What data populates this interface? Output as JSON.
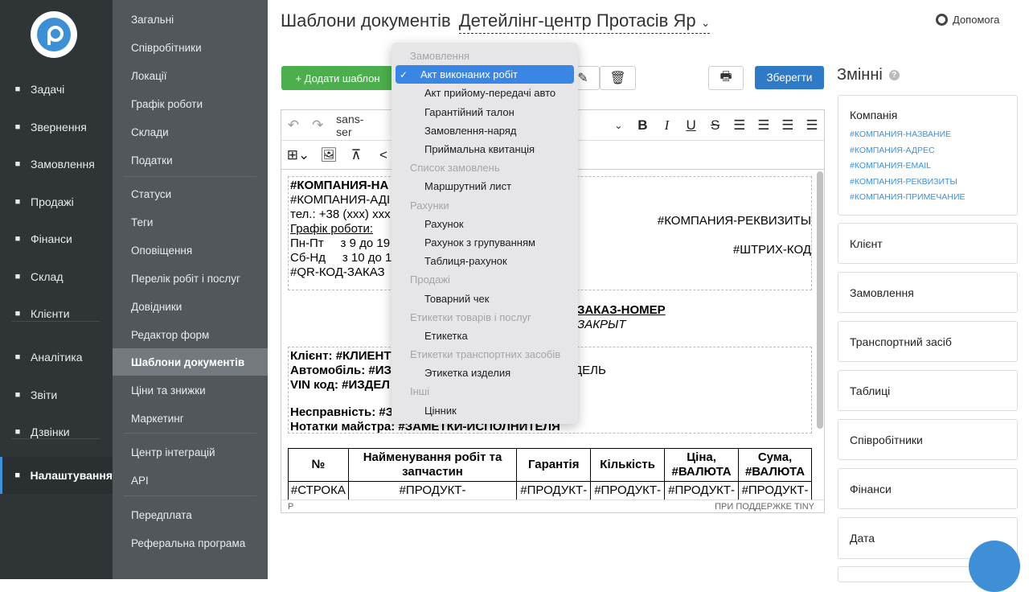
{
  "nav": [
    {
      "icon": "clipboard-icon",
      "label": "Задачі"
    },
    {
      "icon": "filter-icon",
      "label": "Звернення"
    },
    {
      "icon": "order-icon",
      "label": "Замовлення"
    },
    {
      "icon": "cart-icon",
      "label": "Продажі"
    },
    {
      "icon": "dollar-icon",
      "label": "Фінанси"
    },
    {
      "icon": "warehouse-icon",
      "label": "Склад"
    },
    {
      "icon": "users-icon",
      "label": "Клієнти"
    },
    {
      "icon": "chart-icon",
      "label": "Аналітика"
    },
    {
      "icon": "list-icon",
      "label": "Звіти"
    },
    {
      "icon": "phone-icon",
      "label": "Дзвінки"
    },
    {
      "icon": "gear-icon",
      "label": "Налаштування"
    }
  ],
  "submenu": [
    "Загальні",
    "Співробітники",
    "Локації",
    "Графік роботи",
    "Склади",
    "Податки",
    "Статуси",
    "Теги",
    "Оповіщення",
    "Перелік робіт і послуг",
    "Довідники",
    "Редактор форм",
    "Шаблони документів",
    "Ціни та знижки",
    "Маркетинг",
    "Центр інтеграцій",
    "API",
    "Передплата",
    "Реферальна програма"
  ],
  "header": {
    "title": "Шаблони документів",
    "company": "Детейлінг-центр Протасів Яр",
    "help": "Допомога"
  },
  "toolbar": {
    "add": "+ Додати шаблон",
    "save": "Зберегти",
    "font": "sans-ser"
  },
  "doc": {
    "l1": "#КОМПАНИЯ-НА",
    "l2": "#КОМПАНИЯ-АДІ",
    "l3": "тел.: +38 (xxx) xxx",
    "l4": "Графік роботи:",
    "l5": "Пн-Пт     з 9 до 19",
    "l6": "Сб-Нд     з 10 до 1",
    "l7": "#QR-КОД-ЗАКАЗ",
    "req": "#КОМПАНИЯ-РЕКВИЗИТЫ",
    "barcode": "#ШТРИХ-КОД",
    "h1": "ЗАКАЗ-НОМЕР",
    "h2": "ЗАКРЫТ",
    "c1": "Клієнт: #КЛИЕНТ",
    "c2": "Автомобіль: #ИЗ",
    "c2b": "ДЕЛЬ",
    "c3": "VIN код: #ИЗДЕЛ",
    "c4": "Несправність: #З",
    "c5": "Нотатки майстра: #ЗАМЕТКИ-ИСПОЛНИТЕЛЯ",
    "cols": [
      "№",
      "Найменування робіт та запчастин",
      "Гарантія",
      "Кількість",
      "Ціна, #ВАЛЮТА",
      "Сума, #ВАЛЮТА"
    ],
    "row": [
      "#СТРОКА",
      "#ПРОДУКТ-",
      "#ПРОДУКТ-ГАРАНТИЯ",
      "#ПРОДУКТ-",
      "#ПРОДУКТ-",
      "#ПРОДУКТ-"
    ]
  },
  "status": {
    "left": "P",
    "right": "ПРИ ПОДДЕРЖКЕ TINY"
  },
  "variables": {
    "title": "Змінні",
    "company": {
      "label": "Компанія",
      "vars": [
        "#КОМПАНИЯ-НАЗВАНИЕ",
        "#КОМПАНИЯ-АДРЕС",
        "#КОМПАНИЯ-EMAIL",
        "#КОМПАНИЯ-РЕКВИЗИТЫ",
        "#КОМПАНИЯ-ПРИМЕЧАНИЕ"
      ]
    },
    "sections": [
      "Клієнт",
      "Замовлення",
      "Транспортний засіб",
      "Таблиці",
      "Співробітники",
      "Фінанси",
      "Дата"
    ]
  },
  "dropdown": [
    {
      "type": "h",
      "label": "Замовлення"
    },
    {
      "type": "i",
      "label": "Акт виконаних робіт",
      "selected": true
    },
    {
      "type": "i",
      "label": "Акт прийому-передачі авто"
    },
    {
      "type": "i",
      "label": "Гарантійний талон"
    },
    {
      "type": "i",
      "label": "Замовлення-наряд"
    },
    {
      "type": "i",
      "label": "Приймальна квитанція"
    },
    {
      "type": "h",
      "label": "Список замовлень"
    },
    {
      "type": "i",
      "label": "Маршрутний лист"
    },
    {
      "type": "h",
      "label": "Рахунки"
    },
    {
      "type": "i",
      "label": "Рахунок"
    },
    {
      "type": "i",
      "label": "Рахунок з групуванням"
    },
    {
      "type": "i",
      "label": "Таблиця-рахунок"
    },
    {
      "type": "h",
      "label": "Продажі"
    },
    {
      "type": "i",
      "label": "Товарний чек"
    },
    {
      "type": "h",
      "label": "Етикетки товарів і послуг"
    },
    {
      "type": "i",
      "label": "Етикетка"
    },
    {
      "type": "h",
      "label": "Етикетки транспортних засобів"
    },
    {
      "type": "i",
      "label": "Этикетка изделия"
    },
    {
      "type": "h",
      "label": "Інші"
    },
    {
      "type": "i",
      "label": "Цінник"
    }
  ]
}
